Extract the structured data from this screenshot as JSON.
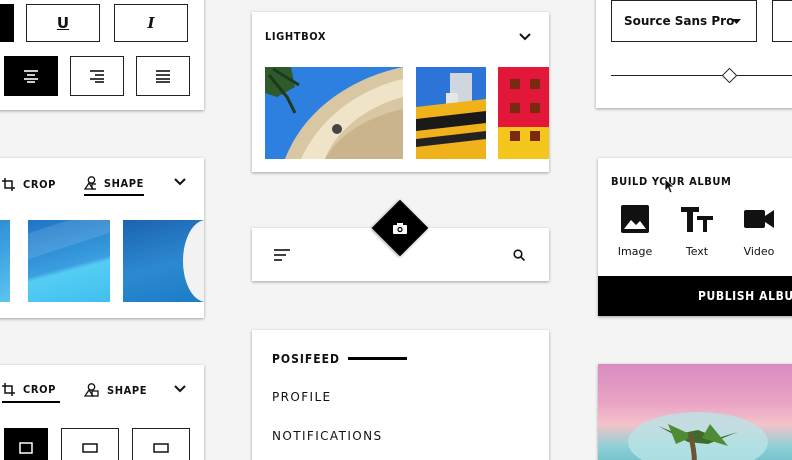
{
  "text_format": {
    "underline_glyph": "U",
    "italic_glyph": "I"
  },
  "lightbox": {
    "title": "LIGHTBOX"
  },
  "crop_card_1": {
    "tabs": [
      {
        "label": "CROP"
      },
      {
        "label": "SHAPE"
      }
    ]
  },
  "crop_card_2": {
    "tabs": [
      {
        "label": "CROP"
      },
      {
        "label": "SHAPE"
      }
    ]
  },
  "font_card": {
    "selected_font": "Source Sans Pro",
    "slider_value": 0.78
  },
  "album": {
    "title": "BUILD YOUR ALBUM",
    "options": [
      {
        "label": "Image",
        "icon": "image-icon"
      },
      {
        "label": "Text",
        "icon": "text-icon"
      },
      {
        "label": "Video",
        "icon": "video-icon"
      }
    ],
    "publish_label": "PUBLISH ALBUM"
  },
  "posifeed": {
    "title": "POSIFEED",
    "items": [
      {
        "label": "PROFILE"
      },
      {
        "label": "NOTIFICATIONS"
      }
    ]
  },
  "colors": {
    "primary": "#000000",
    "surface": "#ffffff",
    "background": "#f4f4f4"
  }
}
